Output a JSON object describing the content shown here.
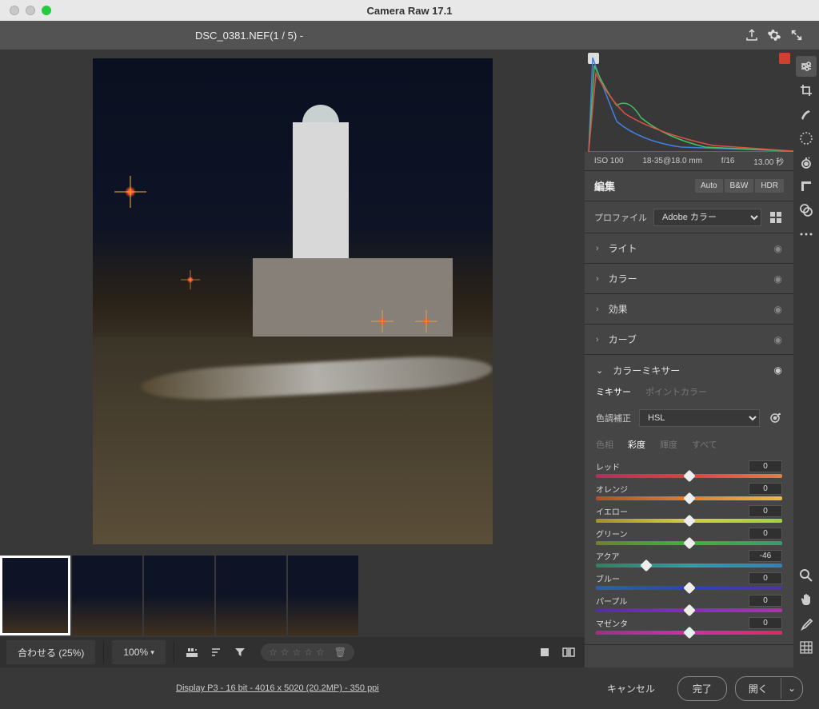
{
  "titlebar": {
    "title": "Camera Raw 17.1"
  },
  "topbar": {
    "filename": "DSC_0381.NEF(1 / 5)  -"
  },
  "metadata": {
    "iso": "ISO 100",
    "lens": "18-35@18.0 mm",
    "aperture": "f/16",
    "shutter": "13.00 秒"
  },
  "edit": {
    "label": "編集",
    "auto": "Auto",
    "bw": "B&W",
    "hdr": "HDR",
    "profile_label": "プロファイル",
    "profile_value": "Adobe カラー"
  },
  "panels": {
    "light": "ライト",
    "color": "カラー",
    "effects": "効果",
    "curves": "カーブ",
    "mixer": {
      "title": "カラーミキサー",
      "tab_mixer": "ミキサー",
      "tab_point": "ポイントカラー",
      "adjust_label": "色調補正",
      "mode": "HSL",
      "hue": "色相",
      "sat": "彩度",
      "lum": "輝度",
      "all": "すべて",
      "sliders": [
        {
          "name": "レッド",
          "value": 0,
          "grad": "linear-gradient(to right,#b03060,#e04040,#e08040)"
        },
        {
          "name": "オレンジ",
          "value": 0,
          "grad": "linear-gradient(to right,#b05030,#e08030,#e0c040)"
        },
        {
          "name": "イエロー",
          "value": 0,
          "grad": "linear-gradient(to right,#a09030,#d0d040,#a0d040)"
        },
        {
          "name": "グリーン",
          "value": 0,
          "grad": "linear-gradient(to right,#708030,#40b040,#30a070)"
        },
        {
          "name": "アクア",
          "value": -46,
          "grad": "linear-gradient(to right,#308060,#30a0a0,#3080c0)"
        },
        {
          "name": "ブルー",
          "value": 0,
          "grad": "linear-gradient(to right,#3060a0,#3040c0,#5030b0)"
        },
        {
          "name": "パープル",
          "value": 0,
          "grad": "linear-gradient(to right,#5030a0,#8030c0,#b030b0)"
        },
        {
          "name": "マゼンタ",
          "value": 0,
          "grad": "linear-gradient(to right,#a03080,#d030a0,#d03060)"
        }
      ]
    }
  },
  "filmstrip": {
    "count": 5,
    "selected": 0
  },
  "toolbar": {
    "fit": "合わせる (25%)",
    "zoom": "100%"
  },
  "footer": {
    "info": "Display P3 - 16 bit - 4016 x 5020 (20.2MP) - 350 ppi",
    "cancel": "キャンセル",
    "done": "完了",
    "open": "開く"
  }
}
